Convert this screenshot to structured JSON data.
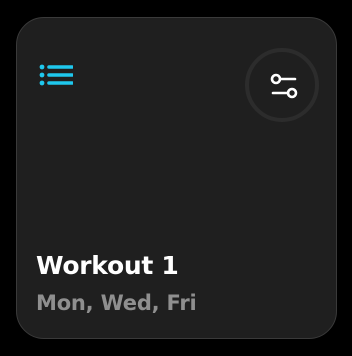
{
  "card": {
    "title": "Workout 1",
    "schedule": "Mon, Wed, Fri"
  },
  "icons": {
    "menu": "list-icon",
    "filter": "sliders-icon"
  },
  "colors": {
    "accent": "#1fc8ee",
    "card_background": "#1f1f1f",
    "title": "#ffffff",
    "subtitle": "#8f8f8f"
  }
}
